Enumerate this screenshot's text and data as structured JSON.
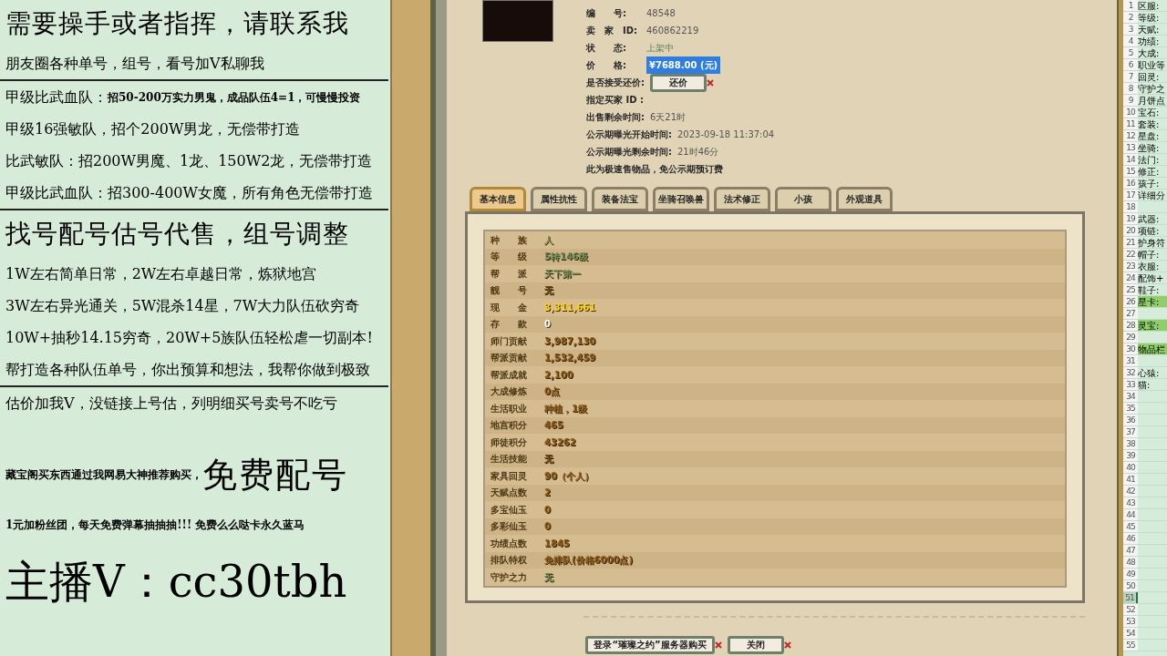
{
  "left_panel": [
    {
      "kind": "heading",
      "parts": [
        {
          "kind": "title",
          "text": "需要操手或者指挥，请联系我"
        }
      ]
    },
    {
      "kind": "body",
      "parts": [
        {
          "kind": "body",
          "text": "朋友圈各种单号，组号，看号加V私聊我"
        }
      ]
    },
    {
      "kind": "divider"
    },
    {
      "kind": "body",
      "parts": [
        {
          "kind": "body",
          "text": "甲级比武血队："
        },
        {
          "kind": "note",
          "text": "招50-200万实力男鬼，成品队伍4=1，可慢慢投资"
        }
      ]
    },
    {
      "kind": "body",
      "parts": [
        {
          "kind": "body",
          "text": "甲级16强敏队，招个200W男龙，无偿带打造"
        }
      ]
    },
    {
      "kind": "body",
      "parts": [
        {
          "kind": "body",
          "text": "比武敏队：招200W男魔、1龙、150W2龙，无偿带打造"
        }
      ]
    },
    {
      "kind": "body",
      "parts": [
        {
          "kind": "body",
          "text": "甲级比武血队：招300-400W女魔，所有角色无偿带打造"
        }
      ]
    },
    {
      "kind": "divider"
    },
    {
      "kind": "heading",
      "parts": [
        {
          "kind": "title",
          "text": "找号配号估号代售，组号调整"
        }
      ]
    },
    {
      "kind": "body",
      "parts": [
        {
          "kind": "body",
          "text": "1W左右简单日常，2W左右卓越日常，炼狱地宫"
        }
      ]
    },
    {
      "kind": "body",
      "parts": [
        {
          "kind": "body",
          "text": "3W左右异光通关，5W混杀14星，7W大力队伍砍穷奇"
        }
      ]
    },
    {
      "kind": "body",
      "parts": [
        {
          "kind": "body",
          "text": "10W+抽秒14.15穷奇，20W+5族队伍轻松虐一切副本!"
        }
      ]
    },
    {
      "kind": "body",
      "parts": [
        {
          "kind": "body",
          "text": "帮打造各种队伍单号，你出预算和想法，我帮你做到极致"
        }
      ]
    },
    {
      "kind": "divider"
    },
    {
      "kind": "body",
      "parts": [
        {
          "kind": "body",
          "text": "估价加我V，没链接上号估，列明细买号卖号不吃亏"
        }
      ]
    },
    {
      "kind": "promo",
      "parts": [
        {
          "kind": "note",
          "text": "藏宝阁买东西通过我网易大神推荐购买，"
        },
        {
          "kind": "big",
          "text": "免费配号"
        }
      ]
    },
    {
      "kind": "small",
      "parts": [
        {
          "kind": "note",
          "text": "1元加粉丝团，每天免费弹幕抽抽抽!!! 免费么么哒卡永久蓝马"
        }
      ]
    },
    {
      "kind": "host",
      "parts": [
        {
          "kind": "host",
          "text": "主播V：cc30tbh"
        }
      ]
    }
  ],
  "info": [
    {
      "label": "编　　号:",
      "value": "48548",
      "kind": "text"
    },
    {
      "label": "卖　家　ID:",
      "value": "460862219",
      "kind": "text"
    },
    {
      "label": "状　　态:",
      "value": "上架中",
      "kind": "status"
    },
    {
      "label": "价　　格:",
      "value": "¥7688.00 (元)",
      "kind": "price",
      "highlighted": true
    },
    {
      "label": "是否接受还价:",
      "value": "还价",
      "kind": "button"
    },
    {
      "label": "指定买家 ID :",
      "kind": "text"
    },
    {
      "label": "出售剩余时间:",
      "value": "6天21时",
      "kind": "text"
    },
    {
      "label": "公示期曝光开始时间:",
      "value": "2023-09-18 11:37:04",
      "kind": "text"
    },
    {
      "label": "公示期曝光剩余时间:",
      "value": "21时46分",
      "kind": "text"
    },
    {
      "label": "此为极速售物品，免公示期预订费",
      "kind": "text"
    }
  ],
  "tabs": [
    {
      "label": "基本信息",
      "selected": true
    },
    {
      "label": "属性抗性",
      "selected": false
    },
    {
      "label": "装备法宝",
      "selected": false
    },
    {
      "label": "坐骑召唤兽",
      "selected": false
    },
    {
      "label": "法术修正",
      "selected": false
    },
    {
      "label": "小孩",
      "selected": false
    },
    {
      "label": "外观道具",
      "selected": false
    }
  ],
  "table": {
    "rows": [
      {
        "label": "种　　族",
        "value": "人",
        "color": "#6b8f5e"
      },
      {
        "label": "等　　级",
        "value": "5转146级",
        "color": "#6b8f5e"
      },
      {
        "label": "帮　　派",
        "value": "天下第一",
        "color": "#6b8f5e"
      },
      {
        "label": "靓　　号",
        "value": "无",
        "color": "#6a4a1a"
      },
      {
        "label": "现　　金",
        "value": "3,311,661",
        "color": "#ffd800"
      },
      {
        "label": "存　　款",
        "value": "0",
        "color": "#ffffff"
      },
      {
        "label": "师门贡献",
        "value": "3,987,130",
        "color": "#8a5a1a"
      },
      {
        "label": "帮派贡献",
        "value": "1,532,459",
        "color": "#8a5a1a"
      },
      {
        "label": "帮派成就",
        "value": "2,100",
        "color": "#8a5a1a"
      },
      {
        "label": "大成修炼",
        "value": "0点",
        "color": "#8a5a1a"
      },
      {
        "label": "生活职业",
        "value": "种植，1级",
        "color": "#8a5a1a"
      },
      {
        "label": "地宫积分",
        "value": "465",
        "color": "#8a5a1a"
      },
      {
        "label": "师徒积分",
        "value": "43262",
        "color": "#8a5a1a"
      },
      {
        "label": "生活技能",
        "value": "无",
        "color": "#6a4a1a"
      },
      {
        "label": "家具回灵",
        "value": "90（个人）",
        "color": "#8a5a1a"
      },
      {
        "label": "天赋点数",
        "value": "2",
        "color": "#8a5a1a"
      },
      {
        "label": "多宝仙玉",
        "value": "0",
        "color": "#8a5a1a"
      },
      {
        "label": "多彩仙玉",
        "value": "0",
        "color": "#8a5a1a"
      },
      {
        "label": "功绩点数",
        "value": "1845",
        "color": "#8a5a1a"
      },
      {
        "label": "排队特权",
        "value": "免排队(价格6000点)",
        "color": "#8a5a1a"
      },
      {
        "label": "守护之力",
        "value": "无",
        "color": "#6b8f5e"
      }
    ]
  },
  "buttons": [
    "登录“璀璨之约”服务器购买",
    "关闭"
  ],
  "sheet": {
    "rows": [
      {
        "number": "1",
        "cell": "区服:",
        "highlighted": false,
        "selected": false
      },
      {
        "number": "2",
        "cell": "等级:",
        "highlighted": false,
        "selected": false
      },
      {
        "number": "3",
        "cell": "天赋:",
        "highlighted": false,
        "selected": false
      },
      {
        "number": "4",
        "cell": "功绩:",
        "highlighted": false,
        "selected": false
      },
      {
        "number": "5",
        "cell": "大成:",
        "highlighted": false,
        "selected": false
      },
      {
        "number": "6",
        "cell": "职业等",
        "highlighted": false,
        "selected": false
      },
      {
        "number": "7",
        "cell": "回灵:",
        "highlighted": false,
        "selected": false
      },
      {
        "number": "8",
        "cell": "守护之",
        "highlighted": false,
        "selected": false
      },
      {
        "number": "9",
        "cell": "月饼点",
        "highlighted": false,
        "selected": false
      },
      {
        "number": "10",
        "cell": "宝石:",
        "highlighted": false,
        "selected": false
      },
      {
        "number": "11",
        "cell": "套装:",
        "highlighted": false,
        "selected": false
      },
      {
        "number": "12",
        "cell": "星盘:",
        "highlighted": false,
        "selected": false
      },
      {
        "number": "13",
        "cell": "坐骑:",
        "highlighted": false,
        "selected": false
      },
      {
        "number": "14",
        "cell": "法门:",
        "highlighted": false,
        "selected": false
      },
      {
        "number": "15",
        "cell": "修正:",
        "highlighted": false,
        "selected": false
      },
      {
        "number": "16",
        "cell": "孩子:",
        "highlighted": false,
        "selected": false
      },
      {
        "number": "17",
        "cell": "详细分",
        "highlighted": false,
        "selected": false
      },
      {
        "number": "18",
        "selected": false
      },
      {
        "number": "19",
        "cell": "武器:",
        "highlighted": false,
        "selected": false
      },
      {
        "number": "20",
        "cell": "项链:",
        "highlighted": false,
        "selected": false
      },
      {
        "number": "21",
        "cell": "护身符",
        "highlighted": false,
        "selected": false
      },
      {
        "number": "22",
        "cell": "帽子:",
        "highlighted": false,
        "selected": false
      },
      {
        "number": "23",
        "cell": "衣服:",
        "highlighted": false,
        "selected": false
      },
      {
        "number": "24",
        "cell": "配饰+",
        "highlighted": false,
        "selected": false
      },
      {
        "number": "25",
        "cell": "鞋子:",
        "highlighted": false,
        "selected": false
      },
      {
        "number": "26",
        "cell": "星卡:",
        "highlighted": true,
        "selected": false
      },
      {
        "number": "27",
        "selected": false
      },
      {
        "number": "28",
        "cell": "灵宝:",
        "highlighted": true,
        "selected": false
      },
      {
        "number": "29",
        "selected": false
      },
      {
        "number": "30",
        "cell": "物品栏",
        "highlighted": true,
        "selected": false
      },
      {
        "number": "31",
        "selected": false
      },
      {
        "number": "32",
        "cell": "心猿:",
        "highlighted": false,
        "selected": false
      },
      {
        "number": "33",
        "cell": "猫:",
        "highlighted": false,
        "selected": false
      },
      {
        "number": "34",
        "selected": false
      },
      {
        "number": "35",
        "selected": false
      },
      {
        "number": "36",
        "selected": false
      },
      {
        "number": "37",
        "selected": false
      },
      {
        "number": "38",
        "selected": false
      },
      {
        "number": "39",
        "selected": false
      },
      {
        "number": "40",
        "selected": false
      },
      {
        "number": "41",
        "selected": false
      },
      {
        "number": "42",
        "selected": false
      },
      {
        "number": "43",
        "selected": false
      },
      {
        "number": "44",
        "selected": false
      },
      {
        "number": "45",
        "selected": false
      },
      {
        "number": "46",
        "selected": false
      },
      {
        "number": "47",
        "selected": false
      },
      {
        "number": "48",
        "selected": false
      },
      {
        "number": "49",
        "selected": false
      },
      {
        "number": "50",
        "selected": false
      },
      {
        "number": "51",
        "selected": true
      },
      {
        "number": "52",
        "selected": false
      },
      {
        "number": "53",
        "selected": false
      },
      {
        "number": "54",
        "selected": false
      },
      {
        "number": "55",
        "selected": false
      }
    ]
  }
}
